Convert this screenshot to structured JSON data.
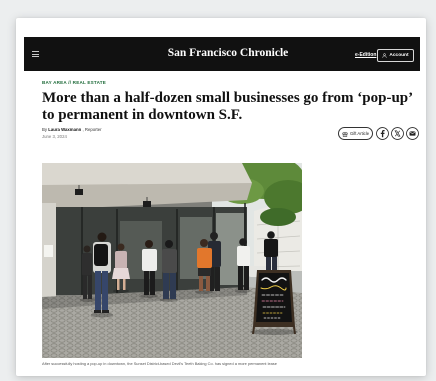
{
  "header": {
    "menu_icon": "hamburger-icon",
    "logo": "San Francisco Chronicle",
    "eedition_label": "e-Edition",
    "account_icon": "user-icon",
    "account_label": "Account"
  },
  "article": {
    "kicker": {
      "section": "BAY AREA",
      "separator": "//",
      "topic": "REAL ESTATE"
    },
    "headline": "More than a half-dozen small businesses go from ‘pop-up’ to permanent in downtown S.F.",
    "byline": {
      "prefix": "By",
      "author": "Laura Waxmann",
      "suffix": ", Reporter"
    },
    "date": "June 3, 2024",
    "share": {
      "gift_icon": "gift-icon",
      "gift_label": "Gift Article",
      "facebook_icon": "facebook-icon",
      "x_icon": "x-icon",
      "email_icon": "email-icon"
    },
    "photo": {
      "caption": "After successfully hosting a pop-up in downtown, the Sunset District-based Devil's Teeth Baking Co. has signed a more permanent lease"
    }
  },
  "colors": {
    "header_bg": "#111111",
    "kicker": "#1f6b3a",
    "text": "#111111",
    "muted": "#777777"
  }
}
